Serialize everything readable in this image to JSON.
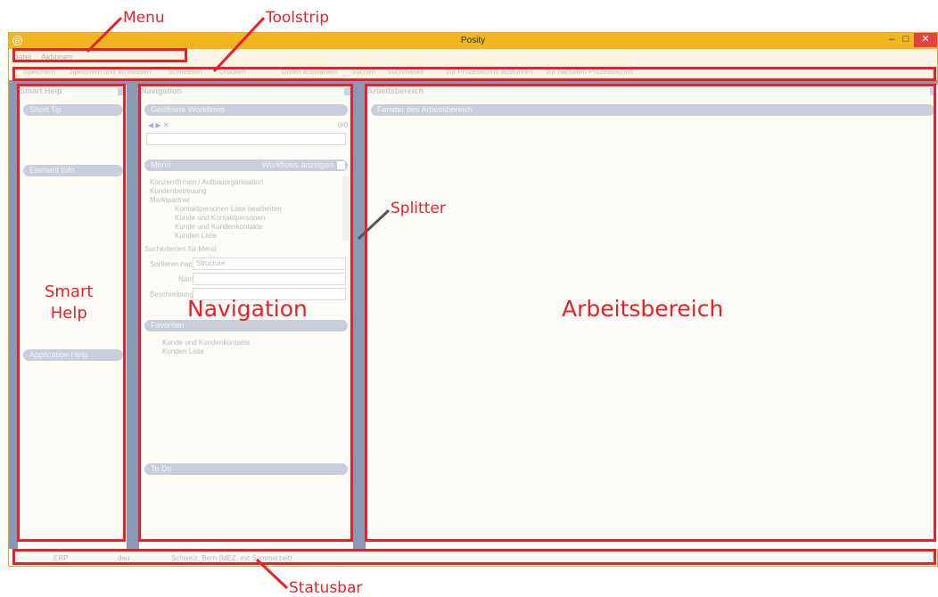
{
  "window": {
    "title": "Posity",
    "icon": "⊝",
    "min": "–",
    "max": "□",
    "close": "✕"
  },
  "menu": {
    "items": [
      "Datei",
      "Aktionen"
    ]
  },
  "toolstrip": {
    "items": [
      "Speichern",
      "Speichern und schliessen",
      "Schliessen",
      "Drucken",
      "Daten auswählen",
      "Suchen",
      "Suchmaske",
      "zur Prozesschritt ausführen",
      "zur nächsten Prozessschritt"
    ]
  },
  "smart_help": {
    "header": "Smart Help",
    "short_tip": "Short Tip",
    "element_info": "Element Info",
    "application_help": "Application Help"
  },
  "navigation": {
    "header": "Navigation",
    "opened_workflows": "Geöffnete Workflows",
    "counter": "0/0",
    "menu_label": "Menü",
    "workflows_toggle": "Workflows anzeigen",
    "tree": [
      "Konzernfirmen / Aufbauorganisation",
      "Kundenbetreuung",
      "Marktpartner",
      "Kontaktpersonen Liste bearbeiten",
      "Kunde und Kontaktpersonen",
      "Kunde und Kundenkontakte",
      "Kunden Liste"
    ],
    "search_criteria": "Suchkriterien für Menü",
    "sort_label": "Sortieren nach",
    "sort_value": "Structure",
    "name_label": "Name",
    "desc_label": "Beschreibung",
    "favorites": "Favoriten",
    "favorite_items": [
      "Kunde und Kundenkontakte",
      "Kunden Liste"
    ],
    "todo": "To Do"
  },
  "workspace": {
    "header": "Arbeitsbereich",
    "window_tab": "Fenster des Arbeitsbereich"
  },
  "statusbar": {
    "items": [
      "ERP",
      "deu",
      "Schweiz, Bern (MEZ, mit Sommerzeit)"
    ]
  },
  "annotations": {
    "menu": "Menu",
    "toolstrip": "Toolstrip",
    "splitter": "Splitter",
    "statusbar": "Statusbar",
    "smart_help_1": "Smart",
    "smart_help_2": "Help",
    "navigation": "Navigation",
    "arbeitsbereich": "Arbeitsbereich"
  },
  "colors": {
    "title": "#f0b521",
    "annotation": "#e8202a",
    "splitter": "#8899b4"
  }
}
